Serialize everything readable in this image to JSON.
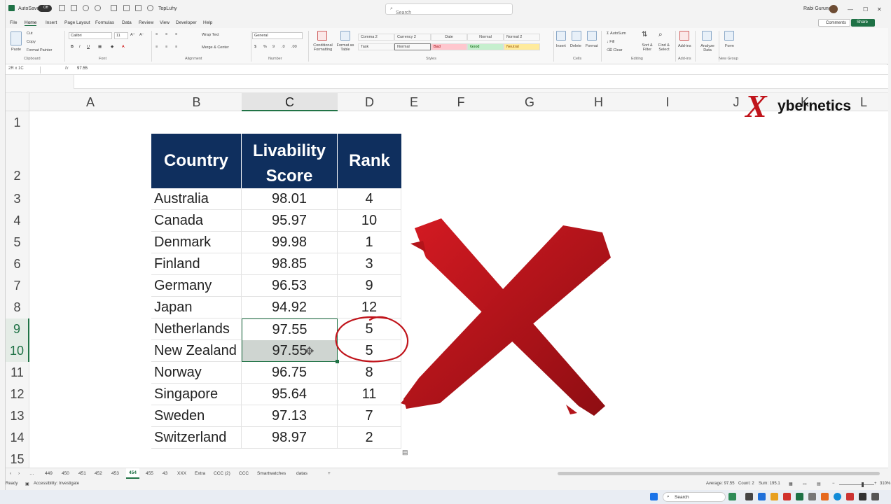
{
  "titlebar": {
    "autosave_label": "AutoSave",
    "autosave_state": "Off",
    "file_name": "TopLuhy",
    "search_placeholder": "Search",
    "user_name": "Rabi Gurung"
  },
  "menu": [
    "File",
    "Home",
    "Insert",
    "Page Layout",
    "Formulas",
    "Data",
    "Review",
    "View",
    "Developer",
    "Help"
  ],
  "menu_active": "Home",
  "comments_label": "Comments",
  "share_label": "Share",
  "ribbon": {
    "clipboard": {
      "paste": "Paste",
      "cut": "Cut",
      "copy": "Copy",
      "format_painter": "Format Painter",
      "label": "Clipboard"
    },
    "font": {
      "name": "Calibri",
      "size": "11",
      "label": "Font"
    },
    "alignment": {
      "wrap": "Wrap Text",
      "merge": "Merge & Center",
      "label": "Alignment"
    },
    "number": {
      "format": "General",
      "label": "Number"
    },
    "styles": {
      "conditional": "Conditional Formatting",
      "format_table": "Format as Table",
      "cells": [
        {
          "name": "Comma 2",
          "bg": "#ffffff",
          "fg": "#333333"
        },
        {
          "name": "Currency 2",
          "bg": "#ffffff",
          "fg": "#333333"
        },
        {
          "name": "Date",
          "bg": "#ffffff",
          "fg": "#333333"
        },
        {
          "name": "Normal",
          "bg": "#ffffff",
          "fg": "#333333"
        },
        {
          "name": "Normal 2",
          "bg": "#ffffff",
          "fg": "#333333"
        },
        {
          "name": "Task",
          "bg": "#ffffff",
          "fg": "#333333"
        },
        {
          "name": "Normal",
          "bg": "#ffffff",
          "fg": "#333333"
        },
        {
          "name": "Bad",
          "bg": "#ffc7ce",
          "fg": "#9c0006"
        },
        {
          "name": "Good",
          "bg": "#c6efce",
          "fg": "#006100"
        },
        {
          "name": "Neutral",
          "bg": "#ffeb9c",
          "fg": "#9c5700"
        }
      ],
      "label": "Styles"
    },
    "cells": {
      "insert": "Insert",
      "delete": "Delete",
      "format": "Format",
      "label": "Cells"
    },
    "editing": {
      "autosum": "AutoSum",
      "fill": "Fill",
      "clear": "Clear",
      "sort": "Sort & Filter",
      "find": "Find & Select",
      "label": "Editing"
    },
    "addins": {
      "addins": "Add-ins",
      "label": "Add-ins"
    },
    "analyze": {
      "label": "Analyze Data"
    },
    "form": {
      "form": "Form",
      "label": "New Group"
    }
  },
  "formula_bar": {
    "name_box": "2R x 1C",
    "fx": "fx",
    "value": "97.55"
  },
  "columns": [
    "A",
    "B",
    "C",
    "D",
    "E",
    "F",
    "G",
    "H",
    "I",
    "J",
    "K",
    "L"
  ],
  "selected_column": "C",
  "rows": [
    "1",
    "2",
    "3",
    "4",
    "5",
    "6",
    "7",
    "8",
    "9",
    "10",
    "11",
    "12",
    "13",
    "14",
    "15"
  ],
  "selected_rows": [
    "9",
    "10"
  ],
  "table": {
    "headers": {
      "country": "Country",
      "score_line1": "Livability",
      "score_line2": "Score",
      "rank": "Rank"
    },
    "header_bg": "#0f2f5e",
    "rows": [
      {
        "country": "Australia",
        "score": "98.01",
        "rank": "4"
      },
      {
        "country": "Canada",
        "score": "95.97",
        "rank": "10"
      },
      {
        "country": "Denmark",
        "score": "99.98",
        "rank": "1"
      },
      {
        "country": "Finland",
        "score": "98.85",
        "rank": "3"
      },
      {
        "country": "Germany",
        "score": "96.53",
        "rank": "9"
      },
      {
        "country": "Japan",
        "score": "94.92",
        "rank": "12"
      },
      {
        "country": "Netherlands",
        "score": "97.55",
        "rank": "5"
      },
      {
        "country": "New Zealand",
        "score": "97.55",
        "rank": "5"
      },
      {
        "country": "Norway",
        "score": "96.75",
        "rank": "8"
      },
      {
        "country": "Singapore",
        "score": "95.64",
        "rank": "11"
      },
      {
        "country": "Sweden",
        "score": "97.13",
        "rank": "7"
      },
      {
        "country": "Switzerland",
        "score": "98.97",
        "rank": "2"
      }
    ]
  },
  "logo": {
    "text": "ybernetics",
    "letter": "X",
    "color": "#c0141b"
  },
  "annotation_color": "#c0141b",
  "sheet_tabs": [
    "449",
    "450",
    "451",
    "452",
    "453",
    "454",
    "455",
    "43",
    "XXX",
    "Extra",
    "CCC (2)",
    "CCC",
    "Smartwatches",
    "datas"
  ],
  "active_sheet": "454",
  "status": {
    "ready": "Ready",
    "accessibility": "Accessibility: Investigate",
    "average": "Average: 97.55",
    "count": "Count: 2",
    "sum": "Sum: 195.1",
    "zoom": "310%"
  },
  "taskbar": {
    "search": "Search"
  }
}
